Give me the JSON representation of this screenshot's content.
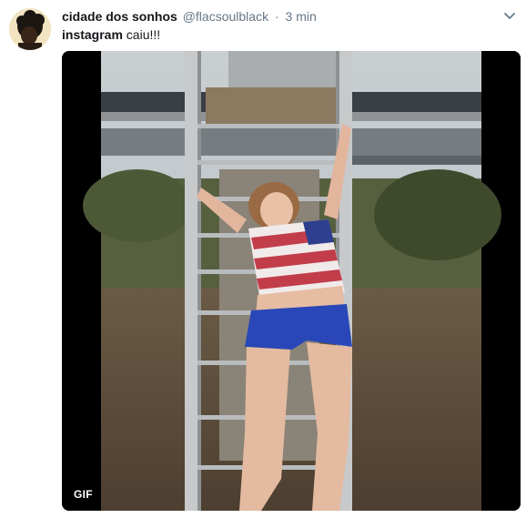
{
  "tweet": {
    "display_name": "cidade dos sonhos",
    "handle": "@flacsoulblack",
    "separator": "·",
    "time": "3 min",
    "text_bold": "instagram",
    "text_rest": " caiu!!!"
  },
  "media": {
    "badge": "GIF"
  },
  "icons": {
    "menu": "chevron-down-icon",
    "avatar": "avatar"
  },
  "colors": {
    "name": "#14171a",
    "secondary": "#657786",
    "badge_bg": "#000000"
  }
}
